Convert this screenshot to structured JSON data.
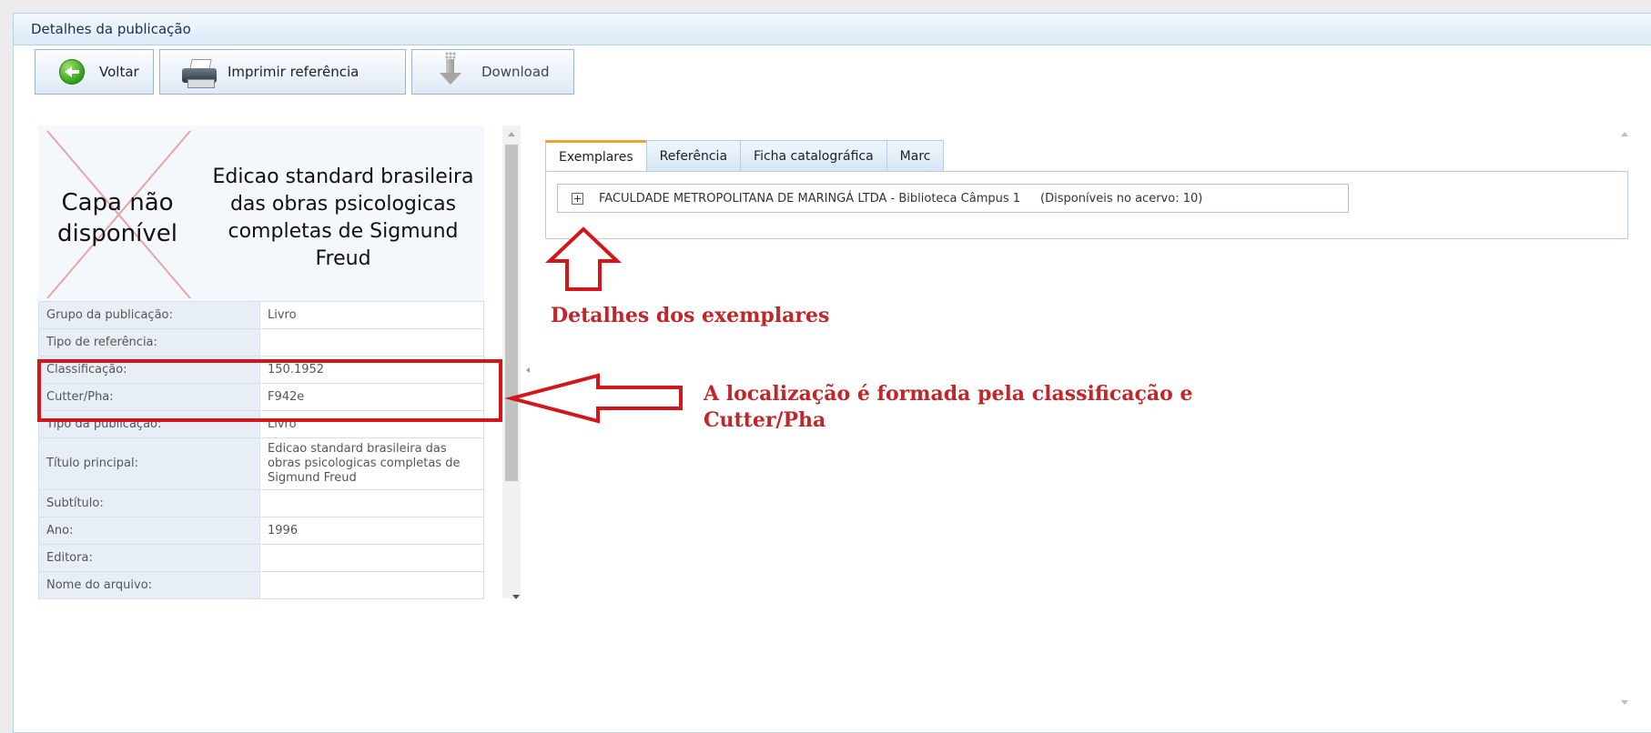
{
  "panel": {
    "title": "Detalhes da publicação"
  },
  "toolbar": {
    "back_label": "Voltar",
    "print_label": "Imprimir referência",
    "download_label": "Download"
  },
  "cover": {
    "placeholder": "Capa não disponível"
  },
  "book": {
    "title": "Edicao standard brasileira das obras psicologicas completas de Sigmund Freud"
  },
  "details": [
    {
      "label": "Grupo da publicação:",
      "value": "Livro"
    },
    {
      "label": "Tipo de referência:",
      "value": ""
    },
    {
      "label": "Classificação:",
      "value": "150.1952"
    },
    {
      "label": "Cutter/Pha:",
      "value": "F942e"
    },
    {
      "label": "Tipo da publicação:",
      "value": "Livro"
    },
    {
      "label": "Título principal:",
      "value": "Edicao standard brasileira das obras psicologicas completas de Sigmund Freud"
    },
    {
      "label": "Subtítulo:",
      "value": ""
    },
    {
      "label": "Ano:",
      "value": "1996"
    },
    {
      "label": "Editora:",
      "value": ""
    },
    {
      "label": "Nome do arquivo:",
      "value": ""
    }
  ],
  "tabs": [
    {
      "label": "Exemplares",
      "active": true
    },
    {
      "label": "Referência",
      "active": false
    },
    {
      "label": "Ficha catalográfica",
      "active": false
    },
    {
      "label": "Marc",
      "active": false
    }
  ],
  "holdings": {
    "library": "FACULDADE METROPOLITANA DE MARINGÁ LTDA - Biblioteca Câmpus 1",
    "availability": "(Disponíveis no acervo: 10)"
  },
  "annotations": {
    "holdings_note": "Detalhes dos exemplares",
    "location_note_line1": "A localização é formada pela classificação e",
    "location_note_line2": "Cutter/Pha"
  },
  "colors": {
    "annotation": "#c0262a",
    "highlight_border": "#d3161a",
    "active_tab_accent": "#f1a133",
    "header_bg": "#dbe9f8"
  }
}
